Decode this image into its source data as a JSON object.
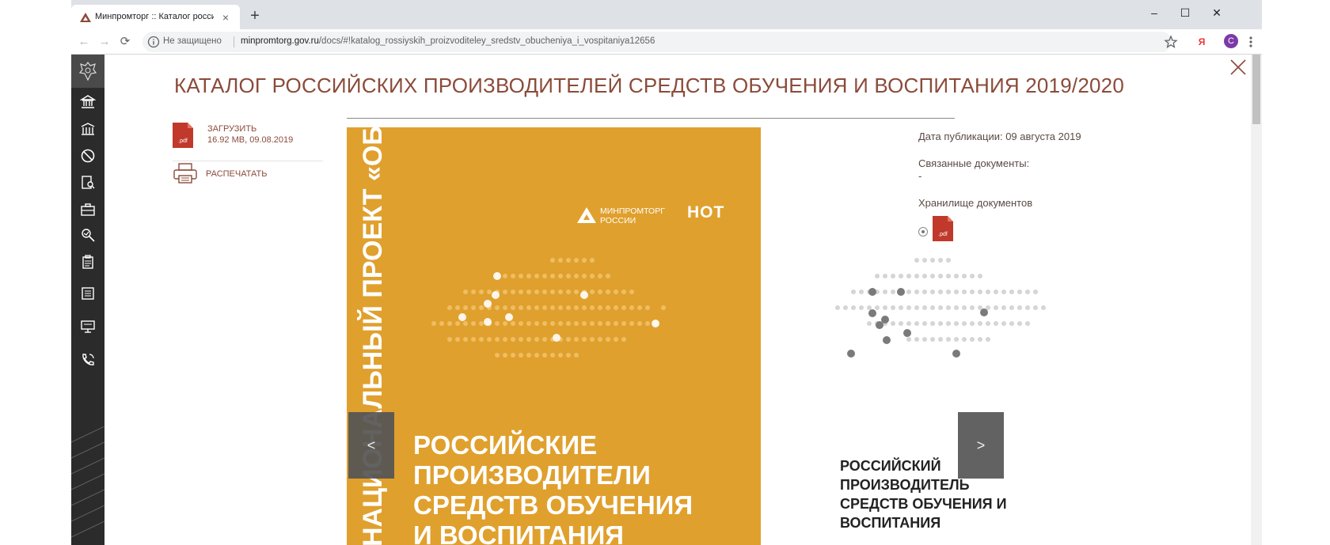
{
  "tab": {
    "title": "Минпромторг :: Каталог российских",
    "close": "×",
    "new_tab": "+"
  },
  "window_controls": {
    "minimize": "–",
    "maximize": "☐",
    "close": "✕"
  },
  "omnibox": {
    "security": "Не защищено",
    "domain": "minpromtorg.gov.ru",
    "path": "/docs/#!katalog_rossiyskih_proizvoditeley_sredstv_obucheniya_i_vospitaniya12656"
  },
  "toolbar": {
    "yandex": "Я",
    "profile_initial": "C"
  },
  "page": {
    "title": "КАТАЛОГ РОССИЙСКИХ ПРОИЗВОДИТЕЛЕЙ СРЕДСТВ ОБУЧЕНИЯ И ВОСПИТАНИЯ 2019/2020",
    "download_label": "ЗАГРУЗИТЬ",
    "download_meta": "16.92 MB, 09.08.2019",
    "print_label": "РАСПЕЧАТАТЬ",
    "pdf_tag": ".pdf"
  },
  "viewer": {
    "vertical_text": "НАЦИОНАЛЬНЫЙ ПРОЕКТ «ОБРАЗОВАНИЕ»",
    "logo_text_1": "МИНПРОМТОРГ",
    "logo_text_2": "РОССИИ",
    "logo_not": "НОТ",
    "headline_main": "РОССИЙСКИЕ ПРОИЗВОДИТЕЛИ СРЕДСТВ ОБУЧЕНИЯ И ВОСПИТАНИЯ",
    "headline_side": "РОССИЙСКИЙ ПРОИЗВОДИТЕЛЬ СРЕДСТВ ОБУЧЕНИЯ И ВОСПИТАНИЯ",
    "prev": "<",
    "next": ">"
  },
  "info": {
    "pub_date": "Дата публикации: 09 августа 2019",
    "related_label": "Связанные документы:",
    "related_value": "-",
    "storage_label": "Хранилище документов"
  },
  "colors": {
    "accent": "#8b4b3a",
    "cover_orange": "#e0a02d",
    "sidebar": "#2b2b2b",
    "pdf_red": "#c0392b"
  }
}
